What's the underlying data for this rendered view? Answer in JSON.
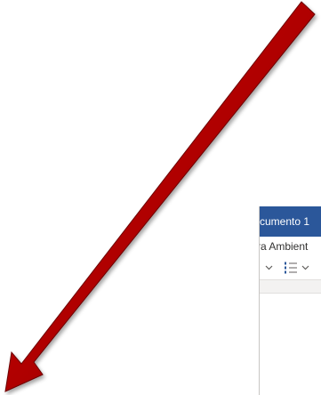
{
  "window": {
    "title": "cumento 1",
    "menu_text": "ra Ambient",
    "title_bar_color": "#2b579a"
  },
  "toolbar": {
    "items": [
      {
        "icon": "chevron-down-icon"
      },
      {
        "icon": "numbered-list-icon"
      },
      {
        "icon": "chevron-down-icon"
      }
    ]
  },
  "overlay": {
    "arrow_color": "#c00000",
    "arrow_direction": "down-left"
  }
}
